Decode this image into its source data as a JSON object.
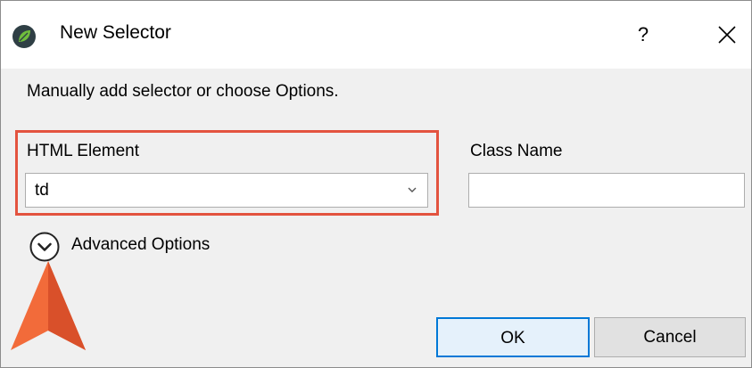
{
  "window": {
    "title": "New Selector",
    "help_label": "?",
    "close_label": "✕",
    "icon": "app-leaf-icon"
  },
  "instructions": "Manually add selector or choose Options.",
  "html_element": {
    "label": "HTML Element",
    "value": "td"
  },
  "class_name": {
    "label": "Class Name",
    "value": ""
  },
  "advanced": {
    "label": "Advanced Options",
    "icon": "chevron-down-circle-icon"
  },
  "buttons": {
    "ok": "OK",
    "cancel": "Cancel"
  },
  "colors": {
    "highlight": "#e3533f",
    "pointer": "#f26b3a",
    "ok_border": "#0078d7",
    "icon_green": "#6fbd3c"
  }
}
